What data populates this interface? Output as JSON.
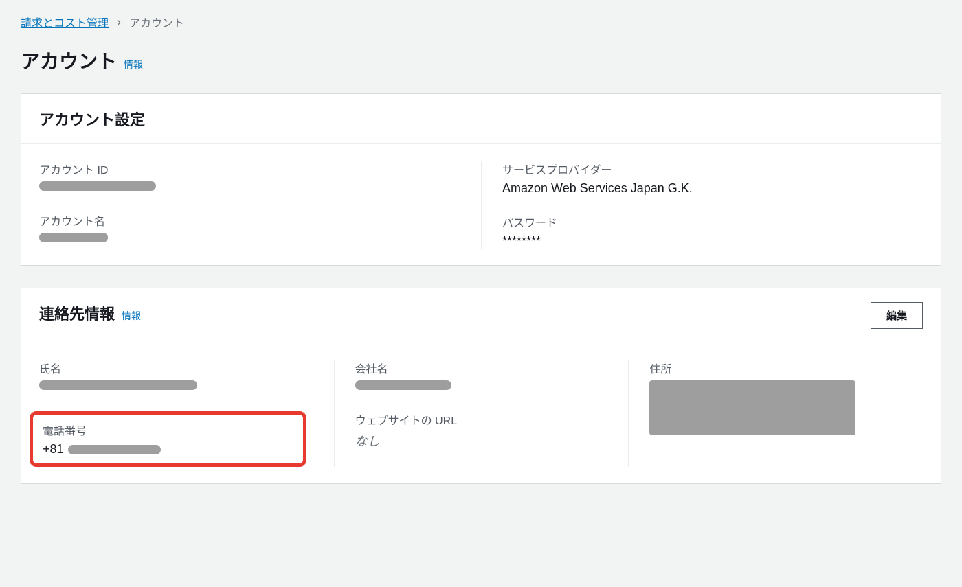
{
  "breadcrumb": {
    "root": "請求とコスト管理",
    "current": "アカウント"
  },
  "page": {
    "title": "アカウント",
    "info_label": "情報"
  },
  "account_settings": {
    "title": "アカウント設定",
    "account_id_label": "アカウント ID",
    "account_name_label": "アカウント名",
    "service_provider_label": "サービスプロバイダー",
    "service_provider_value": "Amazon Web Services Japan G.K.",
    "password_label": "パスワード",
    "password_value": "********"
  },
  "contact_info": {
    "title": "連絡先情報",
    "info_label": "情報",
    "edit_label": "編集",
    "name_label": "氏名",
    "phone_label": "電話番号",
    "phone_prefix": "+81",
    "company_label": "会社名",
    "website_label": "ウェブサイトの URL",
    "website_value": "なし",
    "address_label": "住所"
  }
}
